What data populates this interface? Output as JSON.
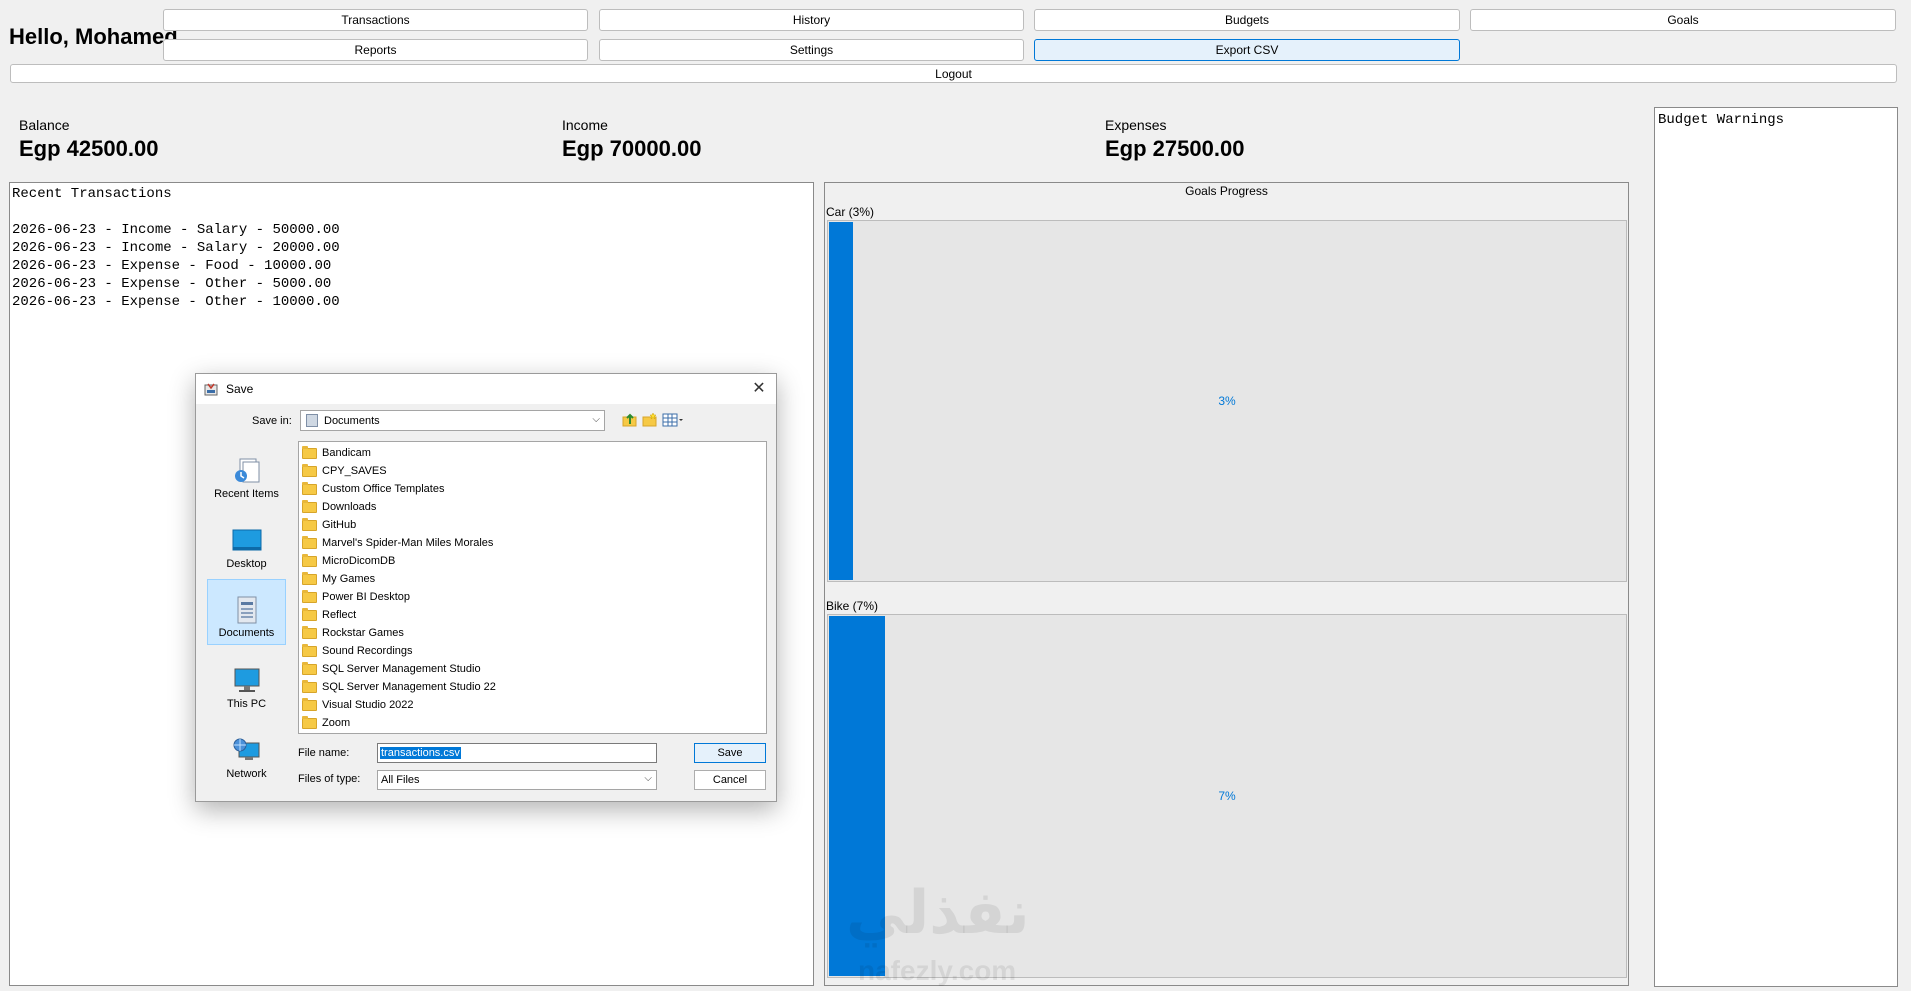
{
  "greeting": "Hello, Mohamed",
  "nav": {
    "transactions": "Transactions",
    "history": "History",
    "budgets": "Budgets",
    "goals": "Goals",
    "reports": "Reports",
    "settings": "Settings",
    "export_csv": "Export CSV",
    "logout": "Logout"
  },
  "stats": {
    "balance_label": "Balance",
    "balance_value": "Egp 42500.00",
    "income_label": "Income",
    "income_value": "Egp 70000.00",
    "expenses_label": "Expenses",
    "expenses_value": "Egp 27500.00"
  },
  "budget_warnings": {
    "title": "Budget Warnings"
  },
  "recent": {
    "title": "Recent Transactions",
    "lines": [
      "2026-06-23 - Income - Salary - 50000.00",
      "2026-06-23 - Income - Salary - 20000.00",
      "2026-06-23 - Expense - Food - 10000.00",
      "2026-06-23 - Expense - Other - 5000.00",
      "2026-06-23 - Expense - Other - 10000.00"
    ]
  },
  "goals": {
    "title": "Goals Progress",
    "items": [
      {
        "label": "Car (3%)",
        "percent_text": "3%",
        "progress": 0.03
      },
      {
        "label": "Bike (7%)",
        "percent_text": "7%",
        "progress": 0.07
      }
    ]
  },
  "watermark": {
    "arabic": "نفذلي",
    "latin": "nafezly.com"
  },
  "dialog": {
    "title": "Save",
    "save_in_label": "Save in:",
    "save_in_value": "Documents",
    "places": [
      {
        "label": "Recent Items",
        "icon": "recent-items-icon"
      },
      {
        "label": "Desktop",
        "icon": "desktop-icon"
      },
      {
        "label": "Documents",
        "icon": "documents-icon"
      },
      {
        "label": "This PC",
        "icon": "computer-icon"
      },
      {
        "label": "Network",
        "icon": "network-icon"
      }
    ],
    "folders": [
      "Bandicam",
      "CPY_SAVES",
      "Custom Office Templates",
      "Downloads",
      "GitHub",
      "Marvel's Spider-Man Miles Morales",
      "MicroDicomDB",
      "My Games",
      "Power BI Desktop",
      "Reflect",
      "Rockstar Games",
      "Sound Recordings",
      "SQL Server Management Studio",
      "SQL Server Management Studio 22",
      "Visual Studio 2022",
      "Zoom"
    ],
    "file_name_label": "File name:",
    "file_name_value": "transactions.csv",
    "files_of_type_label": "Files of type:",
    "files_of_type_value": "All Files",
    "save_button": "Save",
    "cancel_button": "Cancel"
  }
}
